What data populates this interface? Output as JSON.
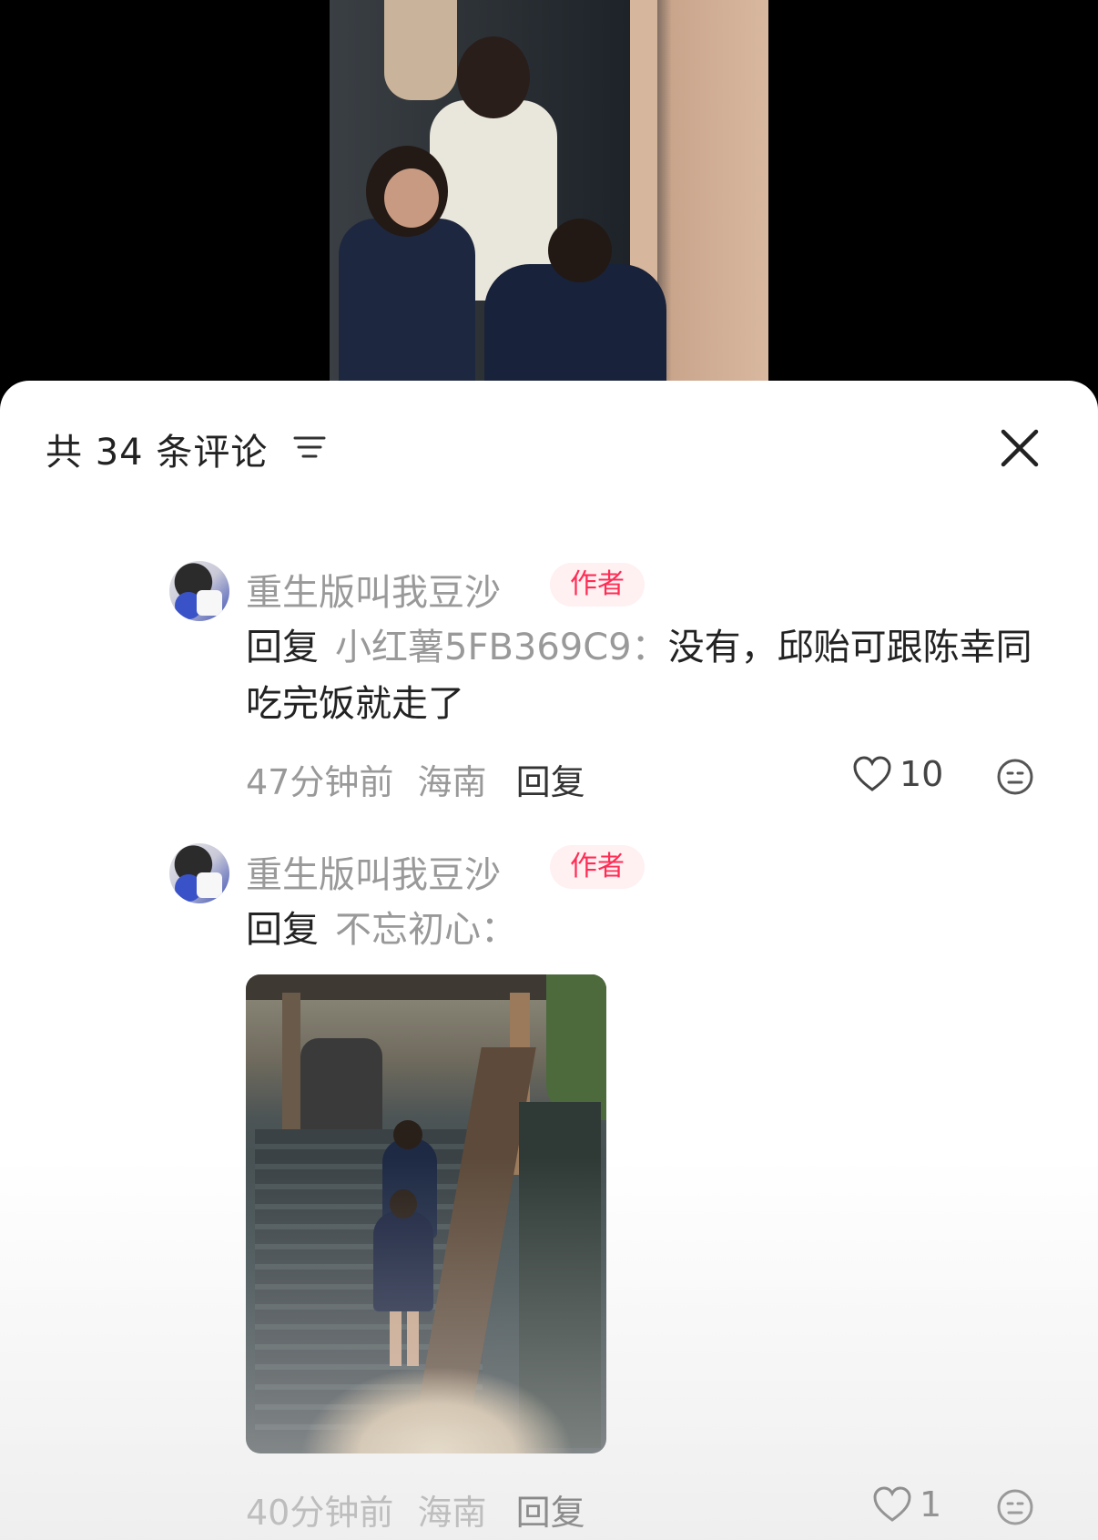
{
  "header": {
    "title": "共 34 条评论",
    "sort_icon": "sort-lines-icon",
    "close_icon": "close-icon"
  },
  "comments": [
    {
      "username": "重生版叫我豆沙",
      "badge": "作者",
      "reply_prefix": "回复",
      "reply_target": "小红薯5FB369C9：",
      "text": "没有，邱贻可跟陈幸同吃完饭就走了",
      "time": "47分钟前",
      "location": "海南",
      "reply_label": "回复",
      "likes": "10"
    },
    {
      "username": "重生版叫我豆沙",
      "badge": "作者",
      "reply_prefix": "回复",
      "reply_target": "不忘初心：",
      "text": "",
      "time": "40分钟前",
      "location": "海南",
      "reply_label": "回复",
      "likes": "1"
    }
  ],
  "colors": {
    "badge_text": "#ff2d55",
    "badge_bg": "#fff0f2",
    "muted": "#999999",
    "primary_text": "#222222"
  }
}
